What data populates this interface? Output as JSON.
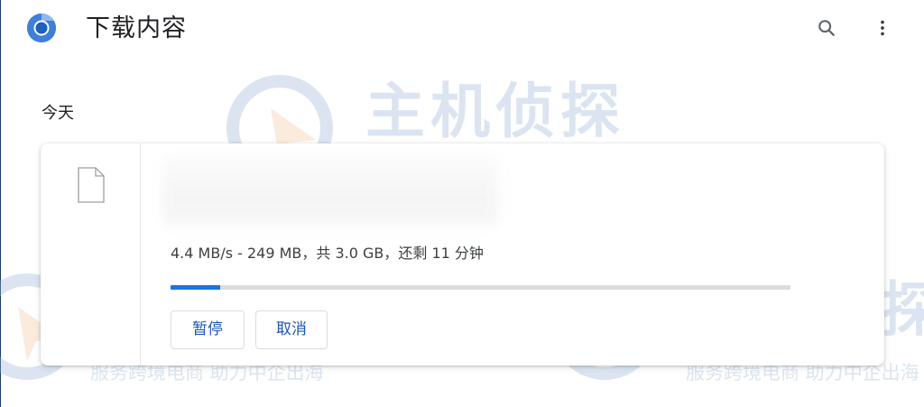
{
  "header": {
    "title": "下载内容",
    "logo_icon": "chromium-logo-icon",
    "search_icon": "search-icon",
    "more_icon": "more-vert-icon"
  },
  "date_group": {
    "label": "今天"
  },
  "download": {
    "file_icon": "file-icon",
    "status": "4.4 MB/s - 249 MB，共 3.0 GB，还剩 11 分钟",
    "progress_percent": 8,
    "pause_label": "暂停",
    "cancel_label": "取消"
  },
  "watermark": {
    "brand": "主机侦探",
    "tagline": "服务跨境电商 助力中企出海"
  },
  "colors": {
    "accent": "#1a73e8",
    "track": "#dadce0",
    "button_text": "#1a56b8",
    "watermark": "#9bb4d6"
  }
}
